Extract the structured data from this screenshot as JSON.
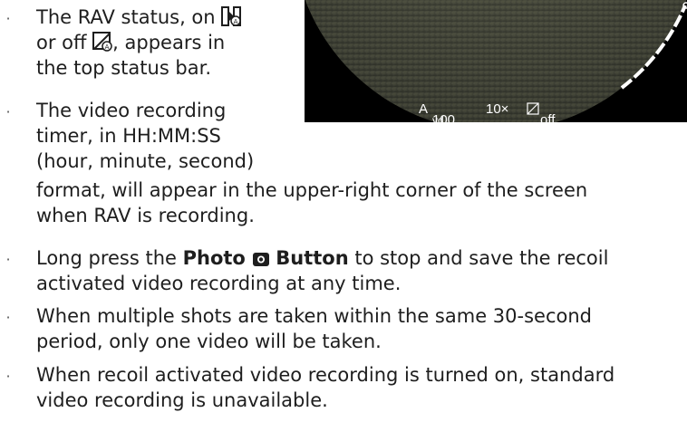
{
  "bullets": [
    {
      "lines": [
        {
          "parts": [
            "The RAV status, on",
            {
              "icon": "rav-on-icon"
            }
          ]
        },
        {
          "parts": [
            "or off",
            {
              "icon": "rav-off-icon"
            },
            ", appears in"
          ]
        },
        {
          "parts": [
            "the top status bar."
          ]
        }
      ]
    },
    {
      "lines": [
        {
          "parts": [
            "The video recording"
          ]
        },
        {
          "parts": [
            "timer, in HH:MM:SS"
          ]
        },
        {
          "parts": [
            "(hour, minute, second)"
          ]
        },
        {
          "parts": [
            "format, will appear in the upper-right corner of the screen"
          ]
        },
        {
          "parts": [
            "when RAV is recording."
          ]
        }
      ]
    },
    {
      "lines": [
        {
          "parts": [
            "Long press the ",
            {
              "bold": "Photo"
            },
            " ",
            {
              "icon": "camera-icon"
            },
            " ",
            {
              "bold": "Button"
            },
            " to stop and save the recoil"
          ]
        },
        {
          "parts": [
            "activated video  recording at any time."
          ]
        }
      ]
    },
    {
      "lines": [
        {
          "parts": [
            "When multiple shots are taken within the same 30-second"
          ]
        },
        {
          "parts": [
            "period, only one video will be taken."
          ]
        }
      ]
    },
    {
      "lines": [
        {
          "parts": [
            "When recoil activated video recording is turned on, standard"
          ]
        },
        {
          "parts": [
            "video recording is unavailable."
          ]
        }
      ]
    }
  ],
  "bullet_char": "·",
  "scope_image": {
    "status_bar": {
      "mode": "A",
      "distance_value": "100",
      "distance_unit": "yd",
      "zoom": "10×",
      "rav_state_icon": "rav-off-icon",
      "rav_state": "off"
    }
  }
}
